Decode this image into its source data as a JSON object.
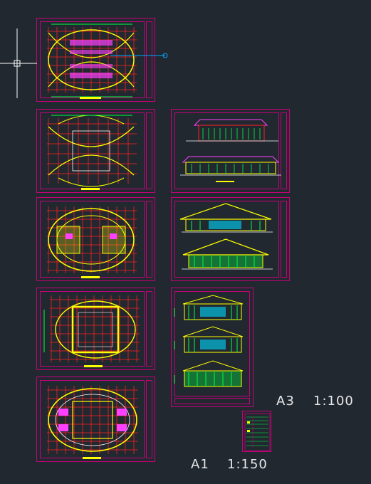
{
  "viewport": {
    "background": "#212830"
  },
  "labels": {
    "a3_size": "A3",
    "a3_scale": "1:100",
    "a1_size": "A1",
    "a1_scale": "1:150"
  },
  "colors": {
    "sheet_border": "#c8007a",
    "grid_red": "#ff2020",
    "line_green": "#00ff40",
    "line_yellow": "#ffff00",
    "line_cyan": "#00d8ff",
    "line_white": "#ffffff",
    "line_magenta": "#ff40ff",
    "crosshair": "#ffffff",
    "tracking_line": "#00a8ff"
  },
  "icons": {
    "cursor": "crosshair-cursor-icon",
    "snap_marker": "snap-endpoint-icon"
  }
}
